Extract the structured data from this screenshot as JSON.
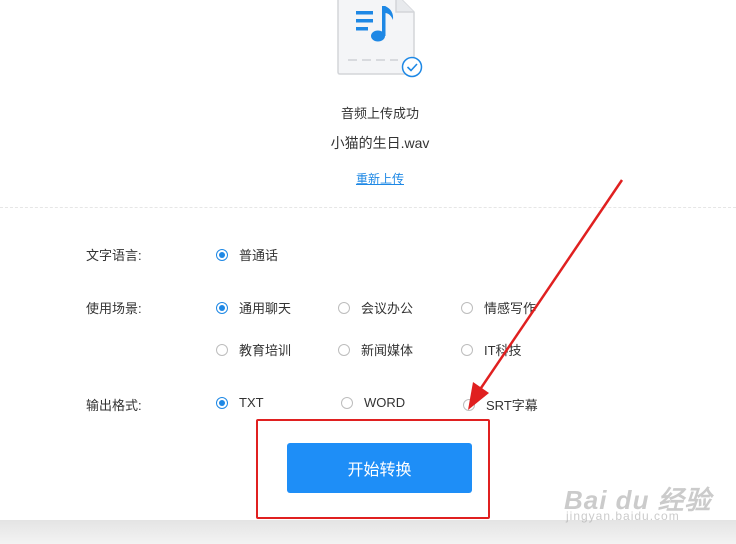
{
  "upload": {
    "status_text": "音频上传成功",
    "file_name": "小猫的生日.wav",
    "reupload_link": "重新上传"
  },
  "form": {
    "language": {
      "label": "文字语言:",
      "options": [
        {
          "label": "普通话",
          "selected": true
        }
      ]
    },
    "scene": {
      "label": "使用场景:",
      "options": [
        {
          "label": "通用聊天",
          "selected": true
        },
        {
          "label": "会议办公",
          "selected": false
        },
        {
          "label": "情感写作",
          "selected": false
        },
        {
          "label": "教育培训",
          "selected": false
        },
        {
          "label": "新闻媒体",
          "selected": false
        },
        {
          "label": "IT科技",
          "selected": false
        }
      ]
    },
    "format": {
      "label": "输出格式:",
      "options": [
        {
          "label": "TXT",
          "selected": true
        },
        {
          "label": "WORD",
          "selected": false
        },
        {
          "label": "SRT字幕",
          "selected": false
        }
      ]
    }
  },
  "actions": {
    "start_label": "开始转换"
  },
  "watermark": {
    "main": "Bai du 经验",
    "sub": "jingyan.baidu.com"
  },
  "colors": {
    "accent": "#1e8ef7",
    "annotation": "#e02020"
  }
}
